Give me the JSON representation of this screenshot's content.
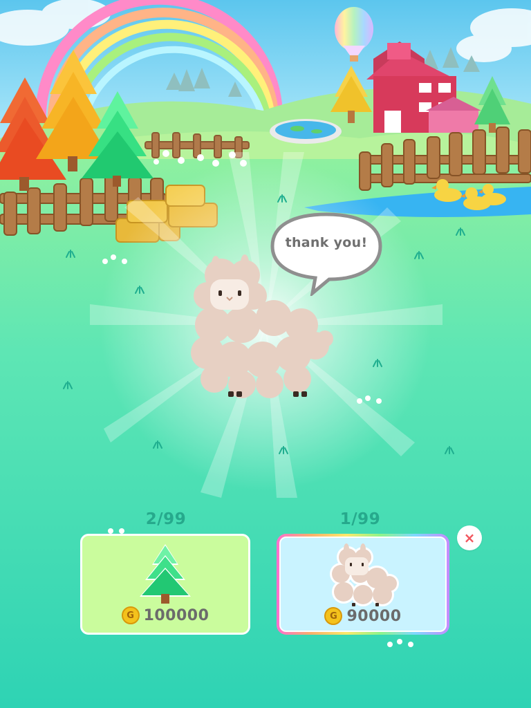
{
  "speech": {
    "text": "thank you!"
  },
  "shop": {
    "items": [
      {
        "id": "tree",
        "count": "2/99",
        "coin_symbol": "G",
        "price": "100000",
        "icon": "pine-tree-icon"
      },
      {
        "id": "alpaca",
        "count": "1/99",
        "coin_symbol": "G",
        "price": "90000",
        "icon": "alpaca-icon"
      }
    ],
    "close_symbol": "×"
  },
  "colors": {
    "grass": "#2fd6b4",
    "tree_card": "#cafc9d",
    "alpaca_card": "#c9f3ff",
    "counter_text": "#26a98c",
    "close_x": "#f2565e",
    "coin": "#f4c21c"
  }
}
